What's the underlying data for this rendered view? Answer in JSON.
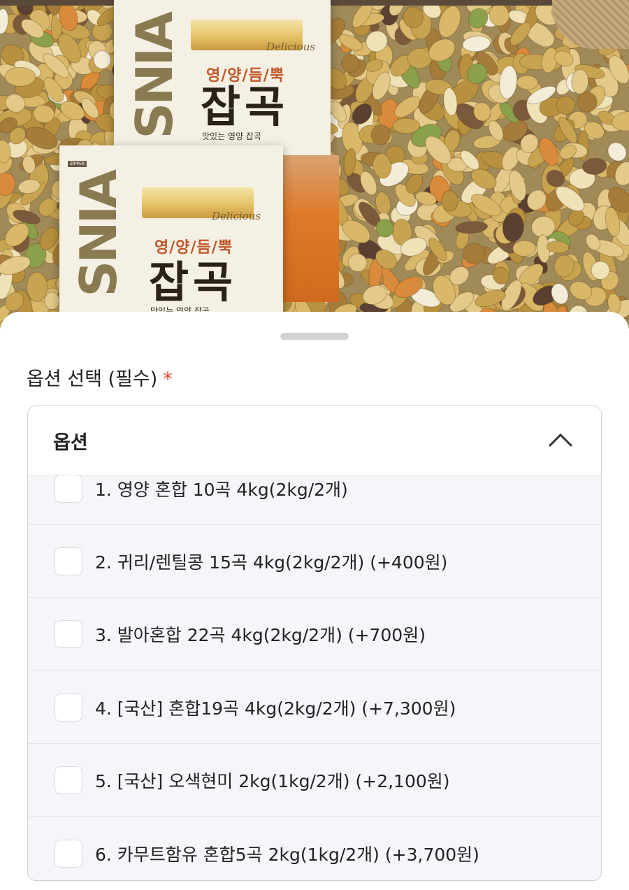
{
  "product_image": {
    "packages": [
      {
        "vertical_text": "SNIA",
        "script_text": "Delicious",
        "brand_text": "영/양/듬/뿍",
        "headline": "잡곡",
        "tagline": "맛있는 영양 잡곡"
      },
      {
        "vertical_text": "SNIA",
        "script_text": "Delicious",
        "brand_text": "영/양/듬/뿍",
        "headline": "잡곡",
        "tagline": "맛있는 영양 잡곡",
        "zip_label": "ZIPPER"
      }
    ]
  },
  "option_section": {
    "title": "옵션 선택 (필수)",
    "required_mark": "*",
    "dropdown": {
      "label": "옵션",
      "expanded": true,
      "toggle_icon": "chevron-up-icon",
      "options": [
        {
          "label": "1. 영양 혼합 10곡 4kg(2kg/2개)",
          "checked": false
        },
        {
          "label": "2. 귀리/렌틸콩 15곡 4kg(2kg/2개) (+400원)",
          "checked": false
        },
        {
          "label": "3. 발아혼합 22곡 4kg(2kg/2개) (+700원)",
          "checked": false
        },
        {
          "label": "4. [국산] 혼합19곡 4kg(2kg/2개) (+7,300원)",
          "checked": false
        },
        {
          "label": "5. [국산] 오색현미 2kg(1kg/2개) (+2,100원)",
          "checked": false
        },
        {
          "label": "6. 카무트함유 혼합5곡 2kg(1kg/2개) (+3,700원)",
          "checked": false
        }
      ]
    }
  },
  "colors": {
    "required_star": "#e8432a",
    "option_list_bg": "#f5f6fa",
    "border": "#cfcfcf"
  }
}
